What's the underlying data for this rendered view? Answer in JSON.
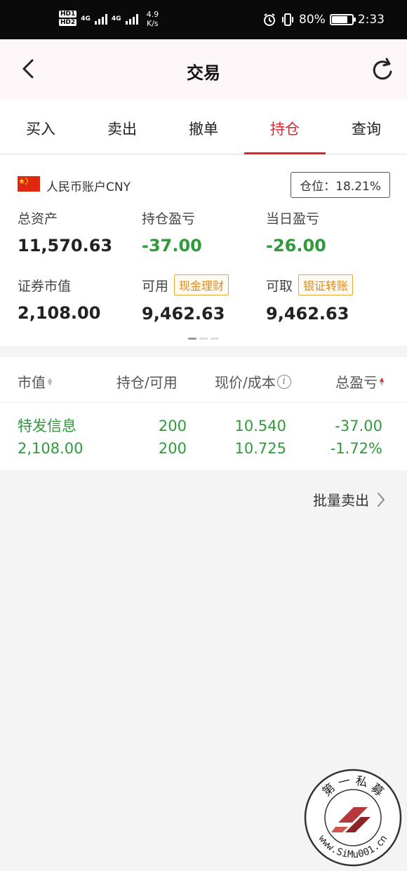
{
  "status_bar": {
    "hd1": "HD1",
    "hd2": "HD2",
    "sig1_label": "4G",
    "sig2_label": "4G",
    "net_speed_value": "4.9",
    "net_speed_unit": "K/s",
    "battery_percent": "80%",
    "battery_level": 0.8,
    "time": "2:33"
  },
  "header": {
    "title": "交易",
    "back_icon": "chevron-left-icon",
    "refresh_icon": "refresh-icon"
  },
  "tabs": [
    {
      "label": "买入",
      "active": false
    },
    {
      "label": "卖出",
      "active": false
    },
    {
      "label": "撤单",
      "active": false
    },
    {
      "label": "持仓",
      "active": true
    },
    {
      "label": "查询",
      "active": false
    }
  ],
  "account": {
    "flag_icon": "china-flag-icon",
    "name": "人民币账户CNY",
    "position_ratio": "仓位：18.21%",
    "total_assets_label": "总资产",
    "total_assets": "11,570.63",
    "position_pnl_label": "持仓盈亏",
    "position_pnl": "-37.00",
    "daily_pnl_label": "当日盈亏",
    "daily_pnl": "-26.00",
    "market_value_label": "证券市值",
    "market_value": "2,108.00",
    "available_label": "可用",
    "available_tag": "现金理财",
    "available": "9,462.63",
    "withdrawable_label": "可取",
    "withdrawable_tag": "银证转账",
    "withdrawable": "9,462.63"
  },
  "holdings": {
    "columns": [
      "市值",
      "持仓/可用",
      "现价/成本",
      "总盈亏"
    ],
    "rows": [
      {
        "name": "特发信息",
        "market_value": "2,108.00",
        "position": "200",
        "available": "200",
        "price": "10.540",
        "cost": "10.725",
        "pnl": "-37.00",
        "pnl_pct": "-1.72%"
      }
    ]
  },
  "batch_sell": "批量卖出",
  "watermark": {
    "text_top": "第 一 私 募",
    "text_bottom": "www.SiMu001.cn"
  },
  "colors": {
    "accent_red": "#e0262b",
    "loss_green": "#2e9b3a",
    "tag_orange": "#e08a1e"
  }
}
